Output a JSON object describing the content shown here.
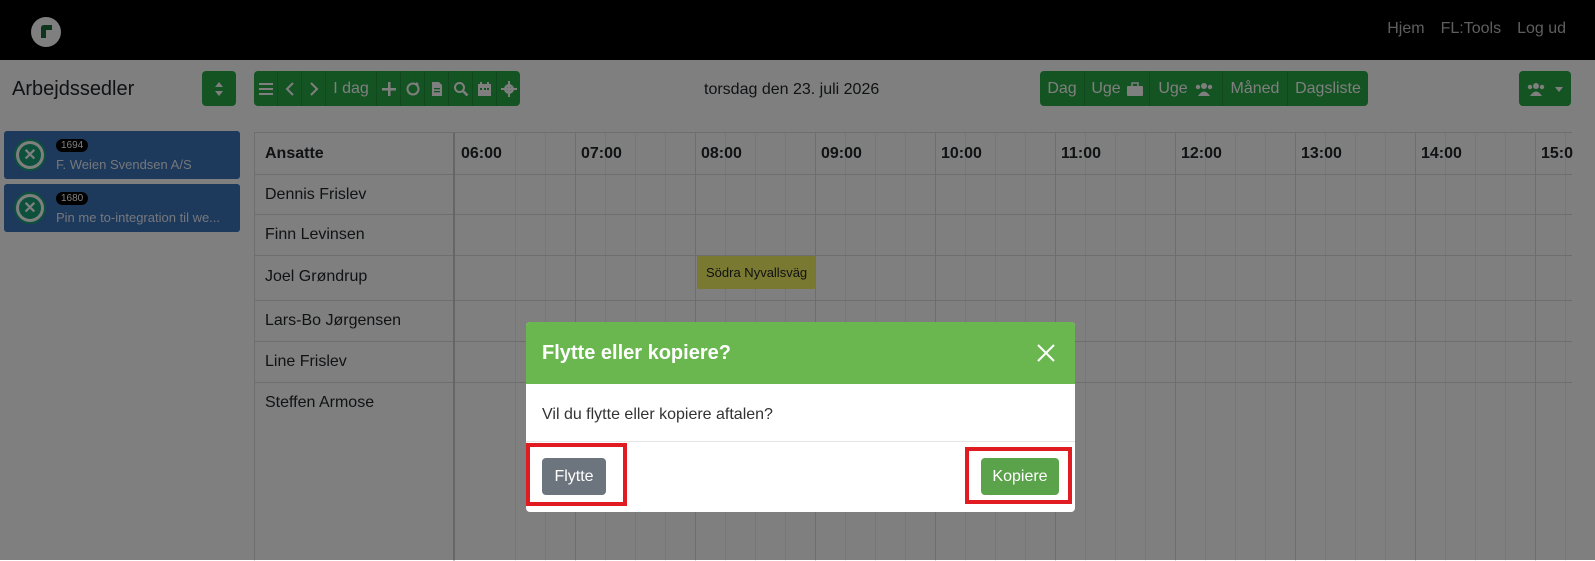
{
  "navbar": {
    "links": [
      "Hjem",
      "FL:Tools",
      "Log ud"
    ]
  },
  "toolbar": {
    "title": "Arbejdssedler",
    "today_label": "I dag",
    "date": "torsdag den 23. juli 2026",
    "views": [
      "Dag",
      "Uge",
      "Uge",
      "Måned",
      "Dagsliste"
    ]
  },
  "work_orders": [
    {
      "badge": "1694",
      "label": "F. Weien Svendsen A/S"
    },
    {
      "badge": "1680",
      "label": "Pin me to-integration til we..."
    }
  ],
  "schedule": {
    "header": "Ansatte",
    "times": [
      "06:00",
      "07:00",
      "08:00",
      "09:00",
      "10:00",
      "11:00",
      "12:00",
      "13:00",
      "14:00",
      "15:0"
    ],
    "employees": [
      "Dennis Frislev",
      "Finn Levinsen",
      "Joel Grøndrup",
      "Lars-Bo Jørgensen",
      "Line Frislev",
      "Steffen Armose"
    ],
    "appointment": "Södra Nyvallsväg"
  },
  "modal": {
    "title": "Flytte eller kopiere?",
    "body": "Vil du flytte eller kopiere aftalen?",
    "move_label": "Flytte",
    "copy_label": "Kopiere"
  },
  "colors": {
    "header_green": "#6ab750",
    "button_green": "#28a745",
    "highlight": "#e11b22"
  }
}
